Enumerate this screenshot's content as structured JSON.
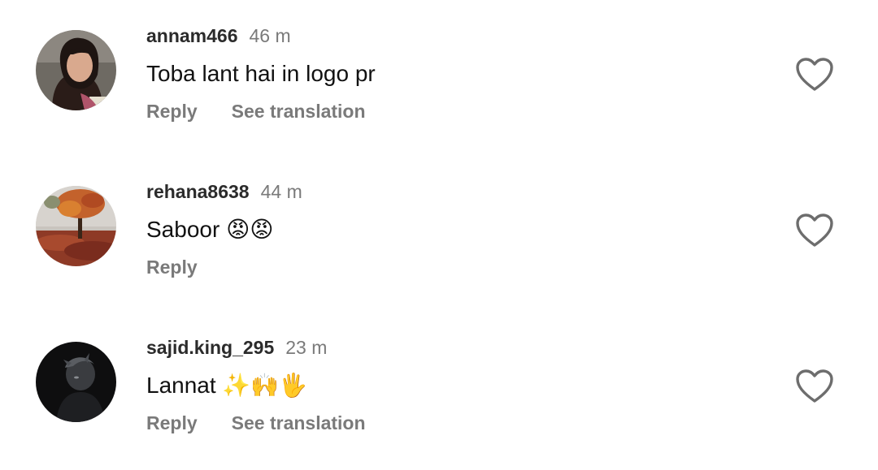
{
  "comments": [
    {
      "username": "annam466",
      "time": "46 m",
      "text": "Toba lant hai in logo pr",
      "actions": [
        "Reply",
        "See translation"
      ],
      "avatar_icon": "user-portrait-avatar",
      "like_icon": "heart-outline-icon"
    },
    {
      "username": "rehana8638",
      "time": "44 m",
      "text": "Saboor 😡😡",
      "actions": [
        "Reply"
      ],
      "avatar_icon": "autumn-tree-avatar",
      "like_icon": "heart-outline-icon"
    },
    {
      "username": "sajid.king_295",
      "time": "23 m",
      "text": "Lannat ✨🙌🖐",
      "actions": [
        "Reply",
        "See translation"
      ],
      "avatar_icon": "dark-silhouette-avatar",
      "like_icon": "heart-outline-icon"
    }
  ],
  "colors": {
    "username": "#2b2b2b",
    "secondary": "#7a7a7a",
    "text": "#111111",
    "background": "#ffffff"
  }
}
